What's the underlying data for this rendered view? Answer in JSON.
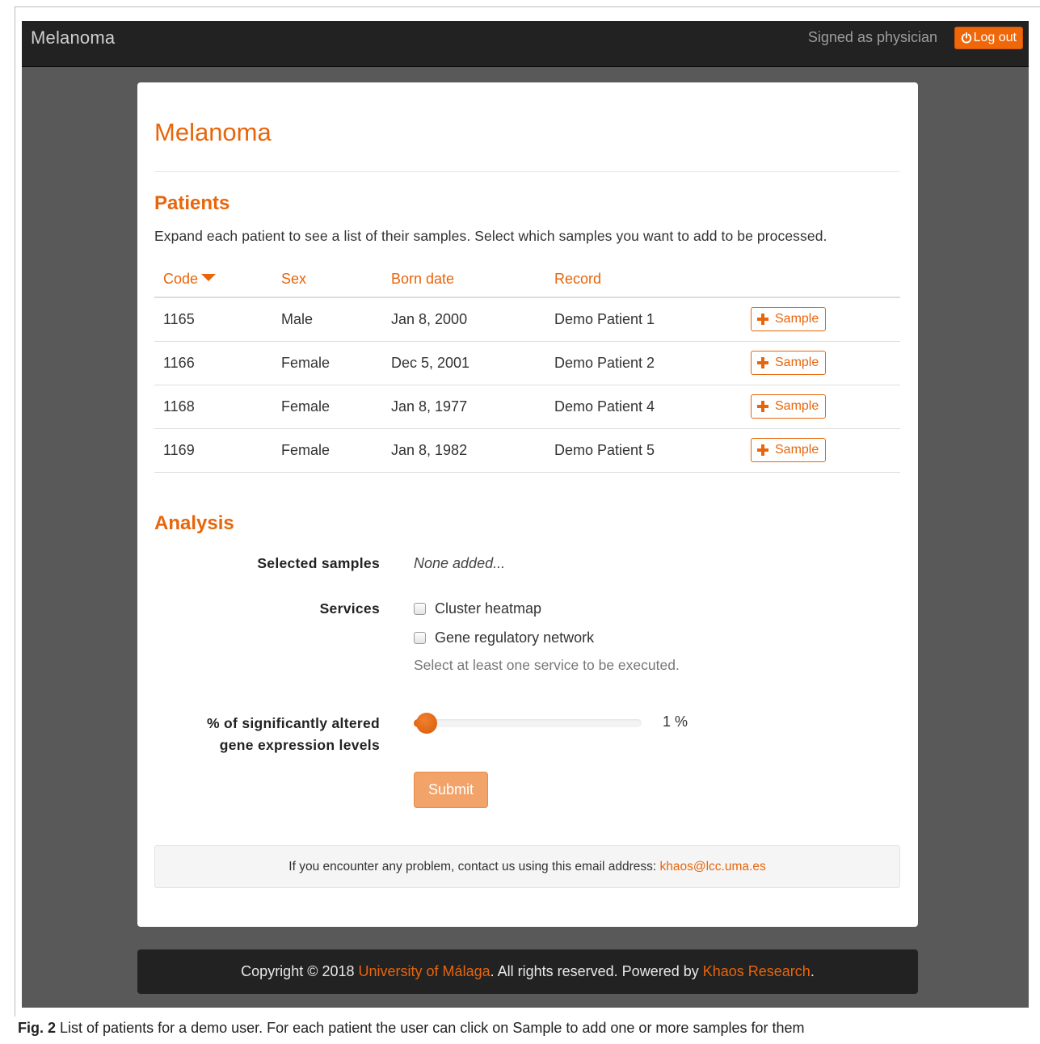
{
  "navbar": {
    "brand": "Melanoma",
    "signed_as": "Signed as physician",
    "logout_label": "Log out"
  },
  "page": {
    "title": "Melanoma"
  },
  "patients": {
    "heading": "Patients",
    "intro": "Expand each patient to see a list of their samples. Select which samples you want to add to be processed.",
    "columns": [
      "Code",
      "Sex",
      "Born date",
      "Record"
    ],
    "rows": [
      {
        "code": "1165",
        "sex": "Male",
        "born": "Jan 8, 2000",
        "record": "Demo Patient 1",
        "action": "Sample"
      },
      {
        "code": "1166",
        "sex": "Female",
        "born": "Dec 5, 2001",
        "record": "Demo Patient 2",
        "action": "Sample"
      },
      {
        "code": "1168",
        "sex": "Female",
        "born": "Jan 8, 1977",
        "record": "Demo Patient 4",
        "action": "Sample"
      },
      {
        "code": "1169",
        "sex": "Female",
        "born": "Jan 8, 1982",
        "record": "Demo Patient 5",
        "action": "Sample"
      }
    ]
  },
  "analysis": {
    "heading": "Analysis",
    "selected_label": "Selected samples",
    "selected_value": "None added...",
    "services_label": "Services",
    "services": [
      {
        "label": "Cluster heatmap",
        "checked": false
      },
      {
        "label": "Gene regulatory network",
        "checked": false
      }
    ],
    "services_help": "Select at least one service to be executed.",
    "pct_label_line1": "% of significantly altered",
    "pct_label_line2": "gene expression levels",
    "pct_value": 1,
    "pct_display": "1 %",
    "submit_label": "Submit"
  },
  "contact": {
    "text": "If you encounter any problem, contact us using this email address: ",
    "email": "khaos@lcc.uma.es"
  },
  "footer": {
    "prefix": "Copyright © 2018 ",
    "university": "University of Málaga",
    "middle": ". All rights reserved. Powered by ",
    "khaos": "Khaos Research",
    "suffix": "."
  },
  "caption": {
    "label": "Fig. 2",
    "text": " List of patients for a demo user. For each patient the user can click on Sample to add one or more samples for them"
  },
  "colors": {
    "accent": "#e8650b",
    "navbar": "#222222",
    "background": "#595959"
  },
  "icons": {
    "logout": "power-icon",
    "sort": "caret-down-icon",
    "add": "plus-icon"
  }
}
